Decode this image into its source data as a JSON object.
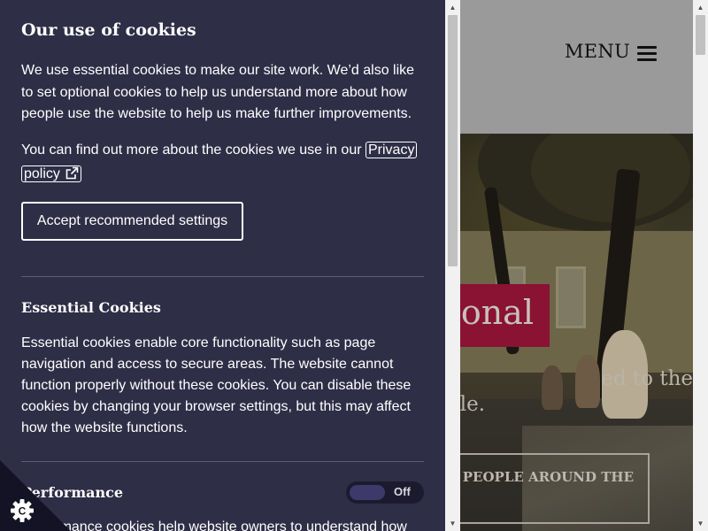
{
  "site": {
    "menu_label": "MENU",
    "hero_title": "ational",
    "hero_sub_line1": "ed to the",
    "hero_sub_line2": "ple.",
    "hero_cta": "ER PEOPLE AROUND THE",
    "colors": {
      "header_bg": "#9a9a9a",
      "title_box": "#8a1233"
    }
  },
  "cookie_panel": {
    "title": "Our use of cookies",
    "intro": "We use essential cookies to make our site work. We’d also like to set optional cookies to help us understand more about how people use the website to help us make further improvements.",
    "more_text": "You can find out more about the cookies we use in our ",
    "policy_link": "Privacy policy",
    "accept_button": "Accept recommended settings",
    "sections": [
      {
        "title": "Essential Cookies",
        "text": "Essential cookies enable core functionality such as page navigation and access to secure areas. The website cannot function properly without these cookies. You can disable these cookies by changing your browser settings, but this may affect how the website functions."
      },
      {
        "title": "Performance",
        "toggle_state": "Off",
        "text": "Performance cookies help website owners to understand how"
      }
    ],
    "colors": {
      "panel_bg": "#2f2e47",
      "badge_bg": "#141326"
    }
  }
}
